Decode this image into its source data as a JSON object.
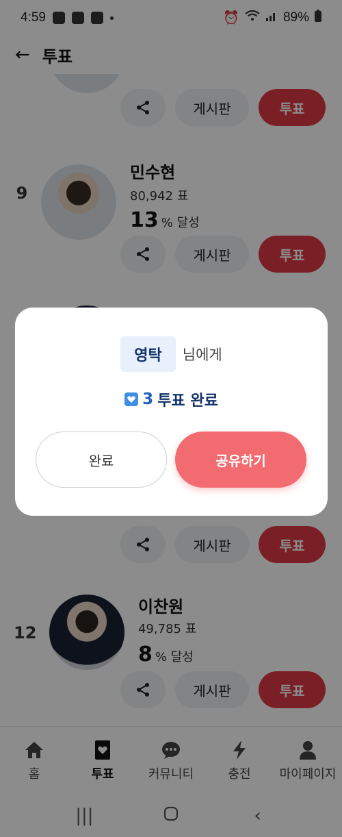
{
  "status": {
    "time": "4:59",
    "battery": "89%"
  },
  "header": {
    "title": "투표"
  },
  "items": [
    {
      "rank": "",
      "name": "",
      "votes": "",
      "pct_value": "",
      "pct_suffix": "% 달성"
    },
    {
      "rank": "9",
      "name": "민수현",
      "votes": "80,942 표",
      "pct_value": "13",
      "pct_suffix": "% 달성"
    },
    {
      "rank": "12",
      "name": "이찬원",
      "votes": "49,785 표",
      "pct_value": "8",
      "pct_suffix": "% 달성"
    }
  ],
  "buttons": {
    "board": "게시판",
    "vote": "투표"
  },
  "nav": [
    {
      "label": "홈",
      "icon": "home-icon"
    },
    {
      "label": "투표",
      "icon": "vote-card-icon"
    },
    {
      "label": "커뮤니티",
      "icon": "chat-bubble-icon"
    },
    {
      "label": "충전",
      "icon": "lightning-icon"
    },
    {
      "label": "마이페이지",
      "icon": "person-icon"
    }
  ],
  "modal": {
    "recipient": "영탁",
    "recipient_suffix": "님에게",
    "vote_count": "3",
    "result_text": "투표 완료",
    "done_label": "완료",
    "share_label": "공유하기"
  },
  "colors": {
    "accent": "#e03a47",
    "share": "#f26b70",
    "chip_bg": "#e7f0fb",
    "navy": "#13336b"
  }
}
